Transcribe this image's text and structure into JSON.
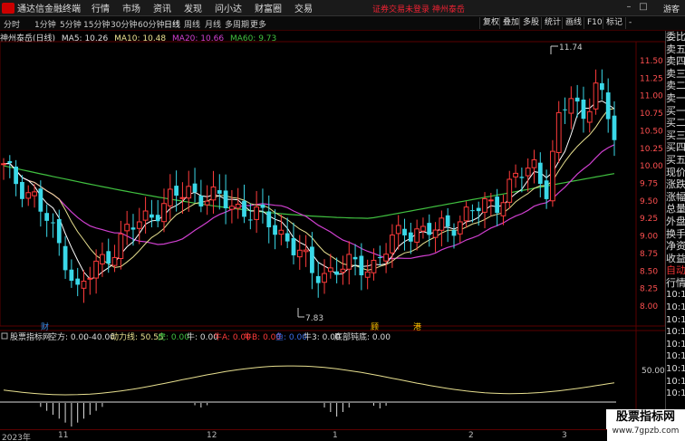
{
  "menubar": {
    "app_title": "通达信金融终端",
    "items": [
      "行情",
      "市场",
      "资讯",
      "发现",
      "问小达",
      "财富圈",
      "交易"
    ],
    "notice": "证券交易未登录  神州泰岳",
    "guest": "游客"
  },
  "toolbar": {
    "periods": [
      "分时",
      "1分钟",
      "5分钟",
      "15分钟",
      "30分钟",
      "60分钟",
      "日线",
      "周线",
      "月线",
      "多周期",
      "更多"
    ],
    "active_period": "日线",
    "tools": [
      "复权",
      "叠加",
      "多股",
      "统计",
      "画线",
      "F10",
      "标记",
      "-"
    ]
  },
  "infoline": {
    "stock": "神州泰岳(日线)",
    "ma5": "MA5: 10.26",
    "ma10": "MA10: 10.48",
    "ma20": "MA20: 10.66",
    "ma60": "MA60: 9.73"
  },
  "price_axis": [
    "11.50",
    "11.25",
    "11.00",
    "10.75",
    "10.50",
    "10.25",
    "10.00",
    "9.75",
    "9.50",
    "9.25",
    "9.00",
    "8.75",
    "8.50",
    "8.25",
    "8.00"
  ],
  "annotations": {
    "high": "11.74",
    "low": "7.83",
    "mark1": "财",
    "mark2": "顾",
    "mark3": "港"
  },
  "indicator": {
    "name": "股票指标网",
    "empty": "空方: 0.00",
    "value": ": -40.00",
    "power": "动力线: 50.55",
    "tiger": "虎: 0.00",
    "bull": "牛: 0.00",
    "bull_a": "牛A: 0.00",
    "bull_b": "牛B: 0.00",
    "fish": "鱼: 0.00",
    "bull3": "牛3: 0.00",
    "bottom": "底部钝底: 0.00",
    "axis_label": "50.00"
  },
  "xaxis": [
    "2023年",
    "11",
    "12",
    "1",
    "2",
    "3"
  ],
  "right_panel": [
    "委比",
    "卖五",
    "卖四",
    "卖三",
    "卖二",
    "卖一",
    "买一",
    "买二",
    "买三",
    "买四",
    "买五",
    "现价",
    "涨跌",
    "涨幅",
    "总量",
    "外盘",
    "换手",
    "净资",
    "收益",
    "自动",
    "行情"
  ],
  "right_times": [
    "10:1",
    "10:1",
    "10:1",
    "10:1",
    "10:1",
    "10:1",
    "10:1",
    "10:1",
    "10:1"
  ],
  "watermark": {
    "title": "股票指标网",
    "url": "www.7gpzb.com"
  },
  "colors": {
    "up": "#ff3b3b",
    "down": "#3ad8e8",
    "ma5": "#ffffff",
    "ma10": "#e8e090",
    "ma20": "#d040d0",
    "ma60": "#40c040",
    "power": "#e8e090"
  }
}
